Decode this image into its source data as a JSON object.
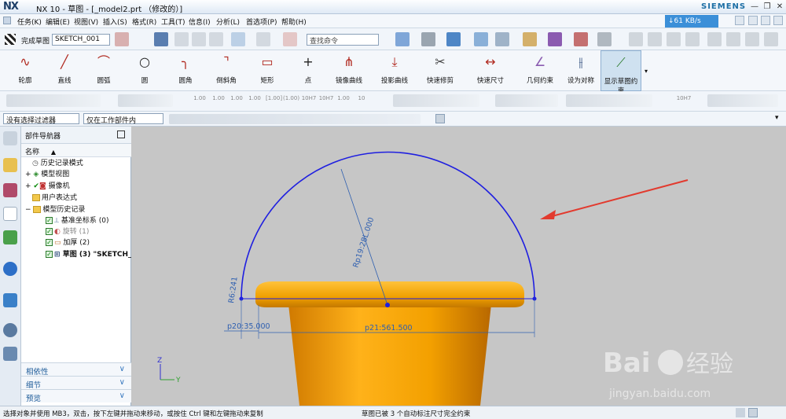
{
  "window": {
    "app_logo": "NX",
    "title": "NX 10 - 草图 - [_model2.prt （修改的）]",
    "brand": "SIEMENS"
  },
  "menu": [
    "任务(K)",
    "编辑(E)",
    "视图(V)",
    "插入(S)",
    "格式(R)",
    "工具(T)",
    "信息(I)",
    "分析(L)",
    "首选项(P)",
    "帮助(H)"
  ],
  "network_speed": "↓61 KB/s",
  "toolbar": {
    "finish_sketch_label": "完成草图",
    "sketch_name": "SKETCH_001",
    "command_search_placeholder": "查找命令"
  },
  "ribbon": [
    {
      "label": "轮廓",
      "icon": "profile-icon"
    },
    {
      "label": "直线",
      "icon": "line-icon"
    },
    {
      "label": "圆弧",
      "icon": "arc-icon"
    },
    {
      "label": "圆",
      "icon": "circle-icon"
    },
    {
      "label": "圆角",
      "icon": "fillet-icon"
    },
    {
      "label": "倒斜角",
      "icon": "chamfer-icon"
    },
    {
      "label": "矩形",
      "icon": "rectangle-icon"
    },
    {
      "label": "点",
      "icon": "point-icon"
    },
    {
      "label": "镜像曲线",
      "icon": "mirror-curve-icon"
    },
    {
      "label": "投影曲线",
      "icon": "project-curve-icon"
    },
    {
      "label": "快速修剪",
      "icon": "quick-trim-icon"
    },
    {
      "label": "快速尺寸",
      "icon": "rapid-dimension-icon"
    },
    {
      "label": "几何约束",
      "icon": "geometric-constraint-icon"
    },
    {
      "label": "设为对称",
      "icon": "make-symmetric-icon"
    },
    {
      "label": "显示草图约束",
      "icon": "show-sketch-constraints-icon"
    }
  ],
  "dimension_toolbar_labels": [
    "1.00",
    "1.00",
    "1.00",
    "1.00",
    "[1.00]",
    "(1.00)",
    "10H7",
    "10H7",
    "1.00",
    "10",
    "10H7"
  ],
  "filters": {
    "type_filter": "没有选择过滤器",
    "scope_filter": "仅在工作部件内"
  },
  "navigator": {
    "title": "部件导航器",
    "column_name": "名称",
    "items": [
      {
        "label": "历史记录模式"
      },
      {
        "label": "模型视图"
      },
      {
        "label": "摄像机"
      },
      {
        "label": "用户表达式"
      },
      {
        "label": "模型历史记录"
      },
      {
        "label": "基准坐标系 (0)"
      },
      {
        "label": "旋转 (1)"
      },
      {
        "label": "加厚 (2)"
      },
      {
        "label": "草图 (3) \"SKETCH_"
      }
    ],
    "panels": [
      "相依性",
      "细节",
      "预览"
    ]
  },
  "viewport": {
    "dimensions": {
      "radius": "Rp19:28L.000",
      "p20": "p20:35.000",
      "p21": "p21:561.500",
      "p22": "R6:241"
    },
    "axis_labels": {
      "z": "Z",
      "y": "Y"
    },
    "watermark": {
      "brand": "Bai",
      "brand2": "经验",
      "url": "jingyan.baidu.com"
    },
    "colors": {
      "sketch_curve": "#1f1fe0",
      "part_body": "#f0a000",
      "arrow": "#e23a2e"
    }
  },
  "status": {
    "left": "选择对象并使用 MB3，双击，按下左键并拖动来移动，或按住 Ctrl 键和左键拖动来复制",
    "center": "草图已被 3 个自动标注尺寸完全约束"
  }
}
